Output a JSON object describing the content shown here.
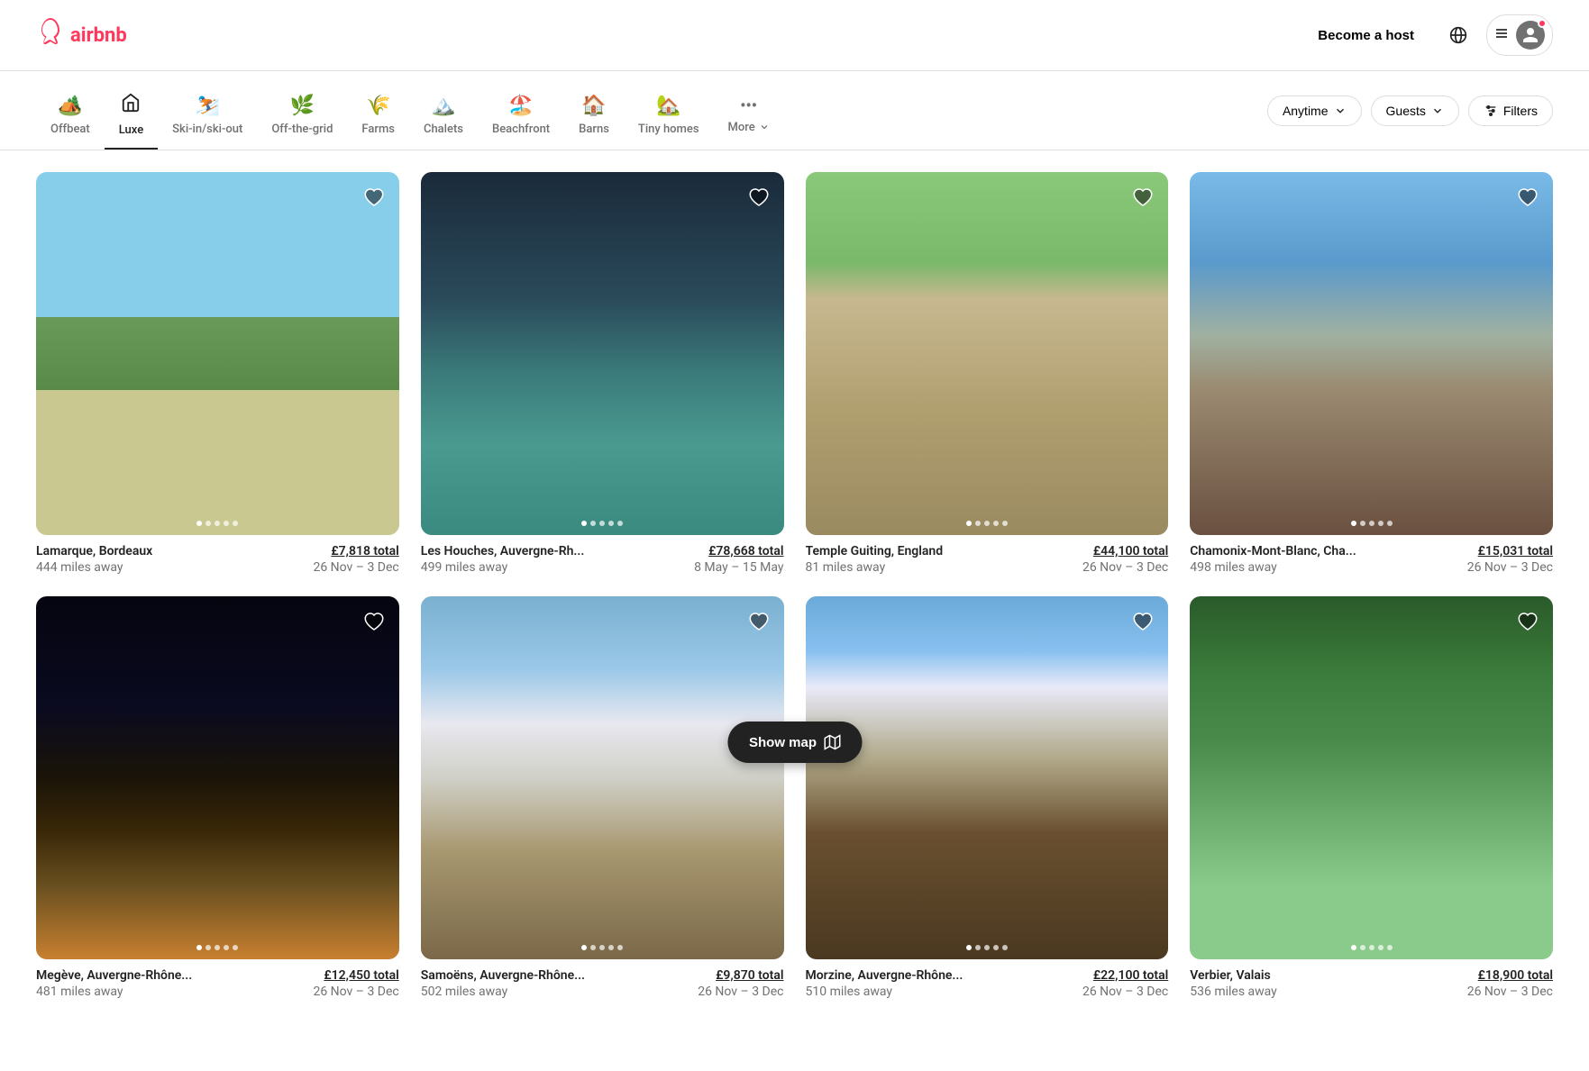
{
  "header": {
    "logo_text": "airbnb",
    "become_host": "Become a host",
    "menu_icon": "☰"
  },
  "categories": [
    {
      "id": "offbeat",
      "label": "Offbeat",
      "icon": "🏚️",
      "active": false
    },
    {
      "id": "luxe",
      "label": "Luxe",
      "icon": "🏛️",
      "active": true
    },
    {
      "id": "ski-in-ski-out",
      "label": "Ski-in/ski-out",
      "icon": "⛷️",
      "active": false
    },
    {
      "id": "off-the-grid",
      "label": "Off-the-grid",
      "icon": "🌿",
      "active": false
    },
    {
      "id": "farms",
      "label": "Farms",
      "icon": "🌾",
      "active": false
    },
    {
      "id": "chalets",
      "label": "Chalets",
      "icon": "🏔️",
      "active": false
    },
    {
      "id": "beachfront",
      "label": "Beachfront",
      "icon": "🏖️",
      "active": false
    },
    {
      "id": "barns",
      "label": "Barns",
      "icon": "🏠",
      "active": false
    },
    {
      "id": "tiny-homes",
      "label": "Tiny homes",
      "icon": "🏡",
      "active": false
    },
    {
      "id": "more",
      "label": "More",
      "icon": "▼",
      "active": false
    }
  ],
  "controls": {
    "anytime_label": "Anytime",
    "guests_label": "Guests",
    "filters_label": "Filters"
  },
  "listings": [
    {
      "id": "1",
      "title": "Lamarque, Bordeaux",
      "distance": "444 miles away",
      "dates": "26 Nov – 3 Dec",
      "price": "£7,818 total",
      "scene": "scene-chateau",
      "dots": 5,
      "active_dot": 0
    },
    {
      "id": "2",
      "title": "Les Houches, Auvergne-Rh...",
      "distance": "499 miles away",
      "dates": "8 May – 15 May",
      "price": "£78,668 total",
      "scene": "scene-pool-indoor",
      "dots": 5,
      "active_dot": 0
    },
    {
      "id": "3",
      "title": "Temple Guiting, England",
      "distance": "81 miles away",
      "dates": "26 Nov – 3 Dec",
      "price": "£44,100 total",
      "scene": "scene-manor",
      "dots": 5,
      "active_dot": 0
    },
    {
      "id": "4",
      "title": "Chamonix-Mont-Blanc, Cha...",
      "distance": "498 miles away",
      "dates": "26 Nov – 3 Dec",
      "price": "£15,031 total",
      "scene": "scene-chalet",
      "dots": 5,
      "active_dot": 0
    },
    {
      "id": "5",
      "title": "Megève, Auvergne-Rhône...",
      "distance": "481 miles away",
      "dates": "26 Nov – 3 Dec",
      "price": "£12,450 total",
      "scene": "scene-night-chalet",
      "dots": 5,
      "active_dot": 0
    },
    {
      "id": "6",
      "title": "Samoëns, Auvergne-Rhône...",
      "distance": "502 miles away",
      "dates": "26 Nov – 3 Dec",
      "price": "£9,870 total",
      "scene": "scene-snow-chalet",
      "dots": 5,
      "active_dot": 0
    },
    {
      "id": "7",
      "title": "Morzine, Auvergne-Rhône...",
      "distance": "510 miles away",
      "dates": "26 Nov – 3 Dec",
      "price": "£22,100 total",
      "scene": "scene-rustic",
      "dots": 5,
      "active_dot": 0
    },
    {
      "id": "8",
      "title": "Verbier, Valais",
      "distance": "536 miles away",
      "dates": "26 Nov – 3 Dec",
      "price": "£18,900 total",
      "scene": "scene-forest",
      "dots": 5,
      "active_dot": 0
    }
  ],
  "show_map": {
    "label": "Show map",
    "icon": "🗺️"
  }
}
